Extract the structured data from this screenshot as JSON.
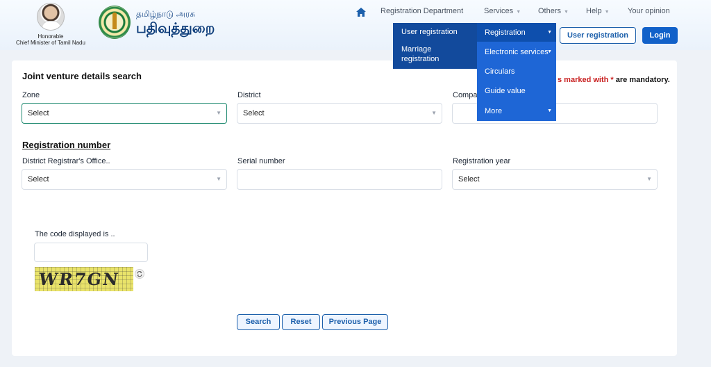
{
  "header": {
    "cm_caption_line1": "Honorable",
    "cm_caption_line2": "Chief Minister of Tamil Nadu",
    "brand_small": "தமிழ்நாடு அரசு",
    "brand_big": "பதிவுத்துறை"
  },
  "nav": {
    "items": [
      {
        "label": "Registration Department"
      },
      {
        "label": "Services"
      },
      {
        "label": "Others"
      },
      {
        "label": "Help"
      },
      {
        "label": "Your opinion"
      }
    ],
    "user_registration_button": "User registration",
    "login_button": "Login"
  },
  "menu": {
    "left_items": [
      "User registration",
      "Marriage",
      "registration"
    ],
    "right_items": [
      "Registration",
      "Electronic services",
      "Circulars",
      "Guide value",
      "More"
    ]
  },
  "form": {
    "title": "Joint venture details search",
    "mandatory_prefix": "s marked with",
    "mandatory_star": "*",
    "mandatory_suffix": "are mandatory.",
    "zone_label": "Zone",
    "zone_value": "Select",
    "district_label": "District",
    "district_value": "Select",
    "company_label": "Compa",
    "section2_title": "Registration number",
    "dro_label": "District Registrar's Office..",
    "dro_value": "Select",
    "serial_label": "Serial number",
    "year_label": "Registration year",
    "year_value": "Select",
    "captcha_label": "The code displayed is ..",
    "captcha_text": "WR7GN",
    "search_button": "Search",
    "reset_button": "Reset",
    "previous_button": "Previous Page"
  },
  "colors": {
    "primary": "#1161c9",
    "menu_dark": "#124a9c",
    "menu_light": "#1e66d6",
    "mandatory_red": "#c81e1e"
  }
}
